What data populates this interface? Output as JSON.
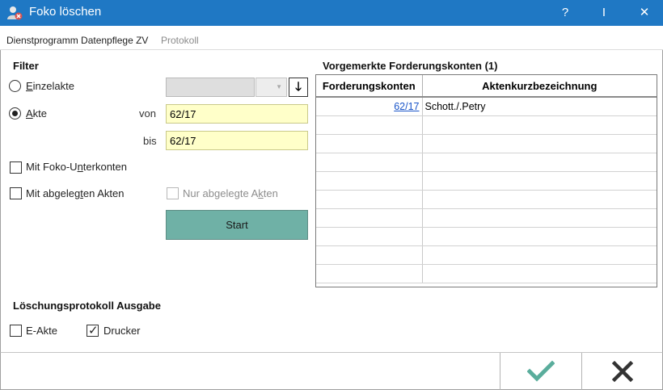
{
  "window": {
    "title": "Foko löschen",
    "help_label": "?",
    "info_label": "I",
    "close_label": "✕"
  },
  "tabs": [
    {
      "label": "Dienstprogramm Datenpflege ZV"
    },
    {
      "label": "Protokoll"
    }
  ],
  "filter": {
    "title": "Filter",
    "einzelakte_label": "Einzelakte",
    "akte_label": "Akte",
    "von_label": "von",
    "bis_label": "bis",
    "von_value": "62/17",
    "bis_value": "62/17",
    "combo_value": "",
    "mit_foko_unterkonten_label": "Mit Foko-Unterkonten",
    "mit_abgelegten_akten_label": "Mit abgelegten Akten",
    "nur_abgelegte_akten_label": "Nur abgelegte Akten",
    "start_label": "Start",
    "selected_mode": "akte"
  },
  "table": {
    "title": "Vorgemerkte Forderungskonten (1)",
    "columns": [
      "Forderungskonten",
      "Aktenkurzbezeichnung"
    ],
    "rows": [
      {
        "konto": "62/17",
        "bezeichnung": "Schott./.Petry"
      }
    ],
    "empty_rows": 9
  },
  "protokoll": {
    "title": "Löschungsprotokoll Ausgabe",
    "e_akte_label": "E-Akte",
    "e_akte_checked": false,
    "drucker_label": "Drucker",
    "drucker_checked": true
  },
  "colors": {
    "titlebar": "#1f78c4",
    "start_button": "#6fb1a6",
    "input_bg": "#ffffc9",
    "ok_check": "#5aad9c",
    "cancel_x": "#333333"
  },
  "icons": {
    "app": "person-delete-icon",
    "sort": "arrow-down-icon",
    "ok": "checkmark-icon",
    "cancel": "close-x-icon"
  }
}
